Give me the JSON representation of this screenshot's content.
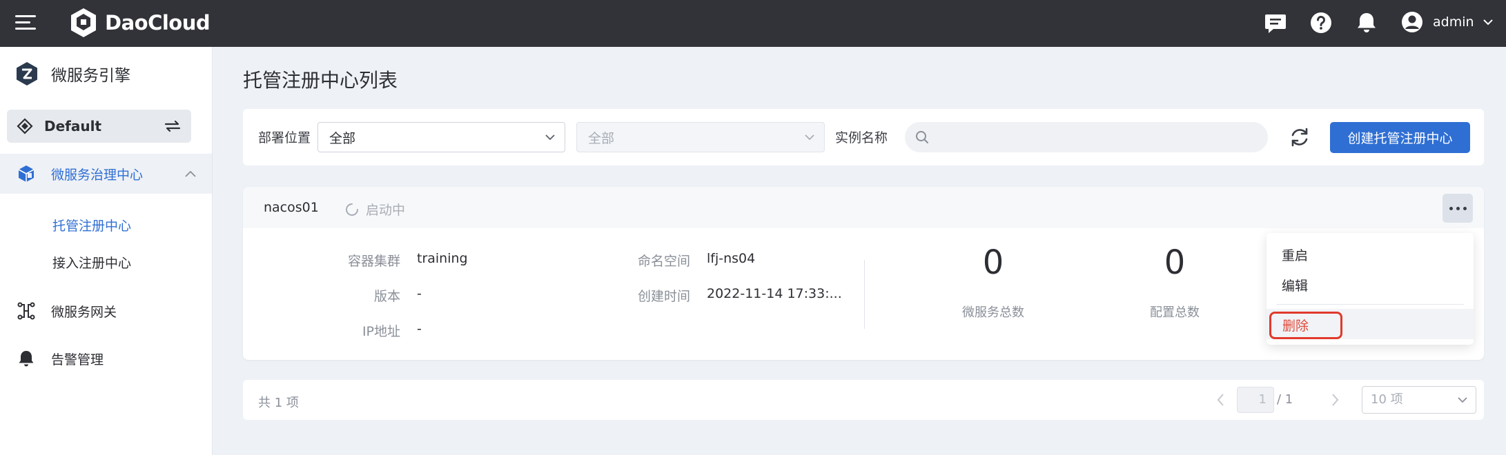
{
  "topbar": {
    "brand": "DaoCloud",
    "user": "admin"
  },
  "sidebar": {
    "module_title": "微服务引擎",
    "workspace": "Default",
    "group": {
      "label": "微服务治理中心",
      "items": [
        {
          "label": "托管注册中心",
          "active": true
        },
        {
          "label": "接入注册中心",
          "active": false
        }
      ]
    },
    "items": [
      {
        "label": "微服务网关",
        "icon": "gateway-icon"
      },
      {
        "label": "告警管理",
        "icon": "bell-icon"
      }
    ]
  },
  "main": {
    "title": "托管注册中心列表",
    "filters": {
      "location_label": "部署位置",
      "location_value": "全部",
      "namespace_value": "全部",
      "name_label": "实例名称",
      "search_placeholder": ""
    },
    "create_label": "创建托管注册中心",
    "instance": {
      "name": "nacos01",
      "status": "启动中",
      "fields": {
        "cluster_label": "容器集群",
        "cluster_value": "training",
        "version_label": "版本",
        "version_value": "-",
        "ip_label": "IP地址",
        "ip_value": "-",
        "ns_label": "命名空间",
        "ns_value": "lfj-ns04",
        "created_label": "创建时间",
        "created_value": "2022-11-14 17:33:..."
      },
      "stats": [
        {
          "value": "0",
          "label": "微服务总数"
        },
        {
          "value": "0",
          "label": "配置总数"
        }
      ]
    },
    "menu": {
      "restart": "重启",
      "edit": "编辑",
      "delete": "删除"
    },
    "pagination": {
      "total": "共 1 项",
      "current_page": "1",
      "total_pages": "/ 1",
      "page_size": "10 项"
    }
  },
  "colors": {
    "topbar": "#323338",
    "primary": "#2f6fd4",
    "danger": "#e04a3a",
    "highlight": "#e0392b"
  }
}
